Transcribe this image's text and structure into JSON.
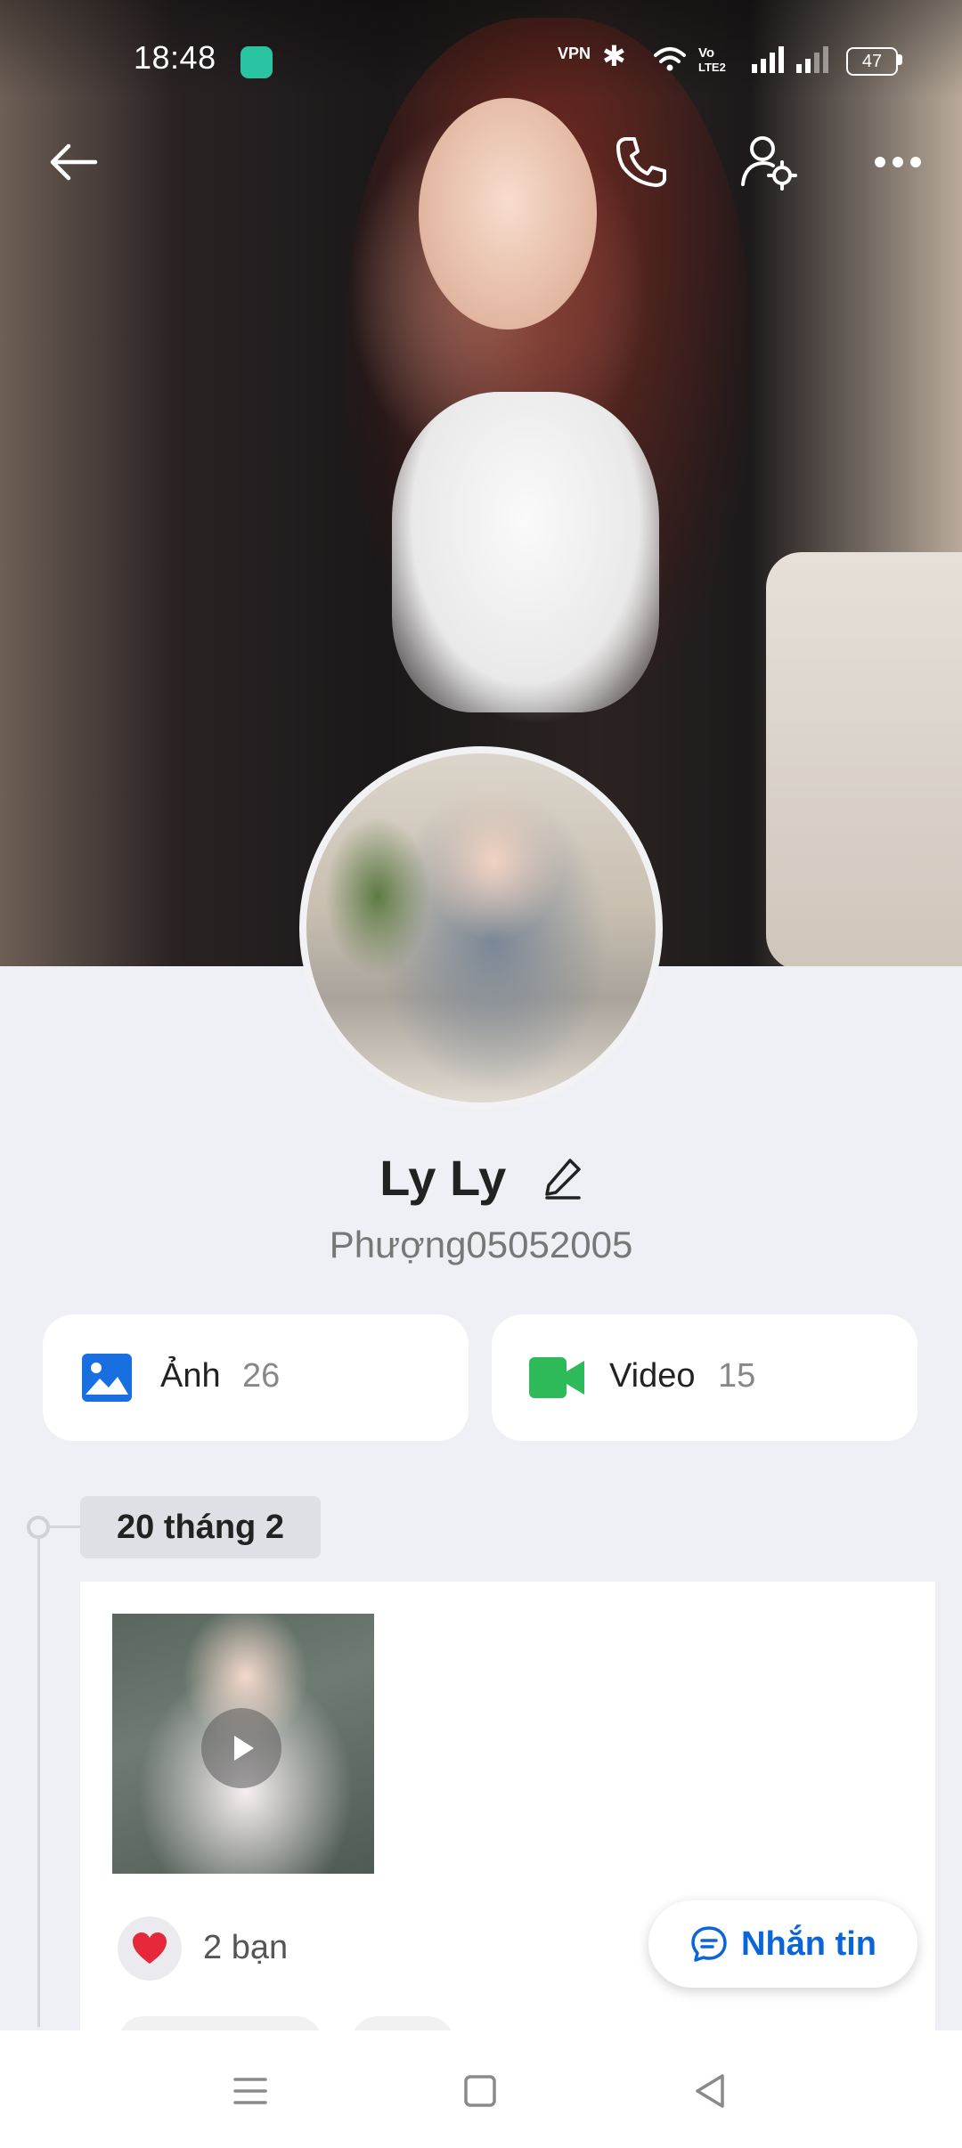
{
  "status_bar": {
    "time": "18:48",
    "vpn": "VPN",
    "volte": "Vo LTE2",
    "battery": "47"
  },
  "profile": {
    "display_name": "Ly Ly",
    "username": "Phượng05052005"
  },
  "media": {
    "photos_label": "Ảnh",
    "photos_count": "26",
    "videos_label": "Video",
    "videos_count": "15"
  },
  "timeline": {
    "date": "20 tháng 2",
    "reactions": "2 bạn"
  },
  "actions": {
    "message_label": "Nhắn tin"
  },
  "colors": {
    "accent": "#0a66d8",
    "photo_icon": "#1a6fe0",
    "video_icon": "#2fba5a",
    "like": "#e5283a"
  },
  "icons": [
    "back-arrow-icon",
    "phone-icon",
    "user-settings-icon",
    "more-icon",
    "edit-icon",
    "image-icon",
    "video-camera-icon",
    "play-icon",
    "heart-icon",
    "chat-icon"
  ]
}
